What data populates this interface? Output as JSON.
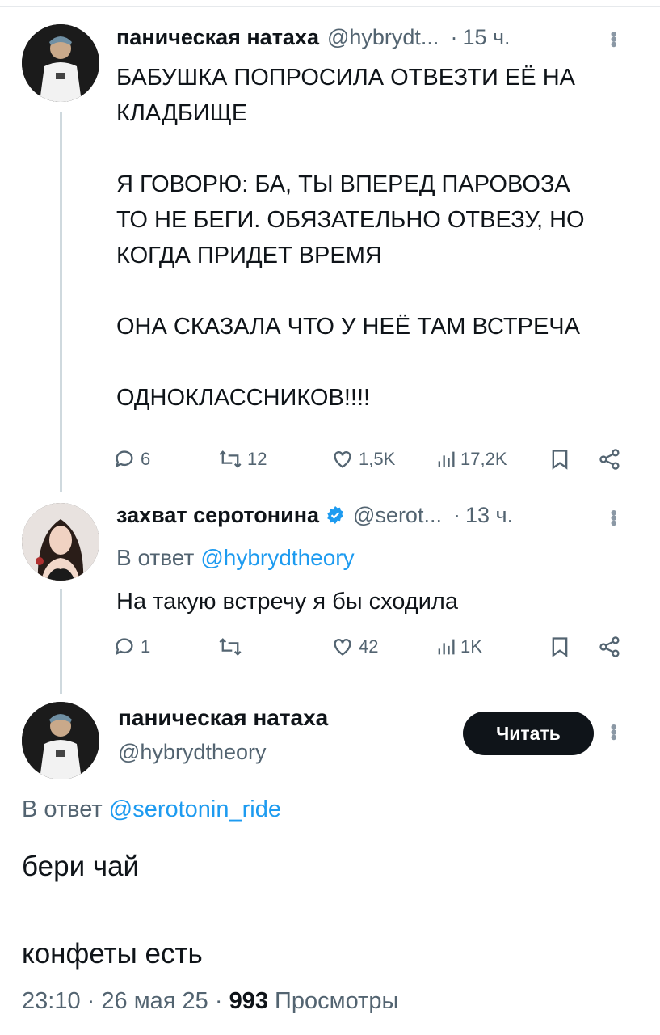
{
  "tweet1": {
    "name": "паническая натаха",
    "handle": "@hybrydt...",
    "dot": "·",
    "time": "15 ч.",
    "lines": [
      "БАБУШКА ПОПРОСИЛА ОТВЕЗТИ ЕЁ НА",
      "КЛАДБИЩЕ",
      "Я ГОВОРЮ: БА, ТЫ ВПЕРЕД ПАРОВОЗА",
      "ТО НЕ БЕГИ. ОБЯЗАТЕЛЬНО ОТВЕЗУ, НО",
      "КОГДА ПРИДЕТ ВРЕМЯ",
      "ОНА СКАЗАЛА ЧТО У НЕЁ ТАМ ВСТРЕЧА",
      "ОДНОКЛАССНИКОВ!!!!"
    ],
    "stats": {
      "replies": "6",
      "retweets": "12",
      "likes": "1,5K",
      "views": "17,2K"
    }
  },
  "tweet2": {
    "name": "захват серотонина",
    "handle": "@serot...",
    "dot": "·",
    "time": "13 ч.",
    "reply_prefix": "В ответ",
    "reply_handle": "@hybrydtheory",
    "text": "На такую встречу я бы сходила",
    "stats": {
      "replies": "1",
      "retweets": "",
      "likes": "42",
      "views": "1K"
    },
    "verified_color": "#1d9bf0"
  },
  "main": {
    "name": "паническая натаха",
    "handle": "@hybrydtheory",
    "follow_label": "Читать",
    "reply_prefix": "В ответ",
    "reply_handle": "@serotonin_ride",
    "line1": "бери чай",
    "line2": "конфеты есть",
    "time": "23:10",
    "sep": "·",
    "date": "26 мая 25",
    "views_count": "993",
    "views_label": "Просмотры"
  },
  "colors": {
    "link": "#1d9bf0",
    "muted": "#536471",
    "text": "#0f1419",
    "thread": "#cfd9de"
  }
}
